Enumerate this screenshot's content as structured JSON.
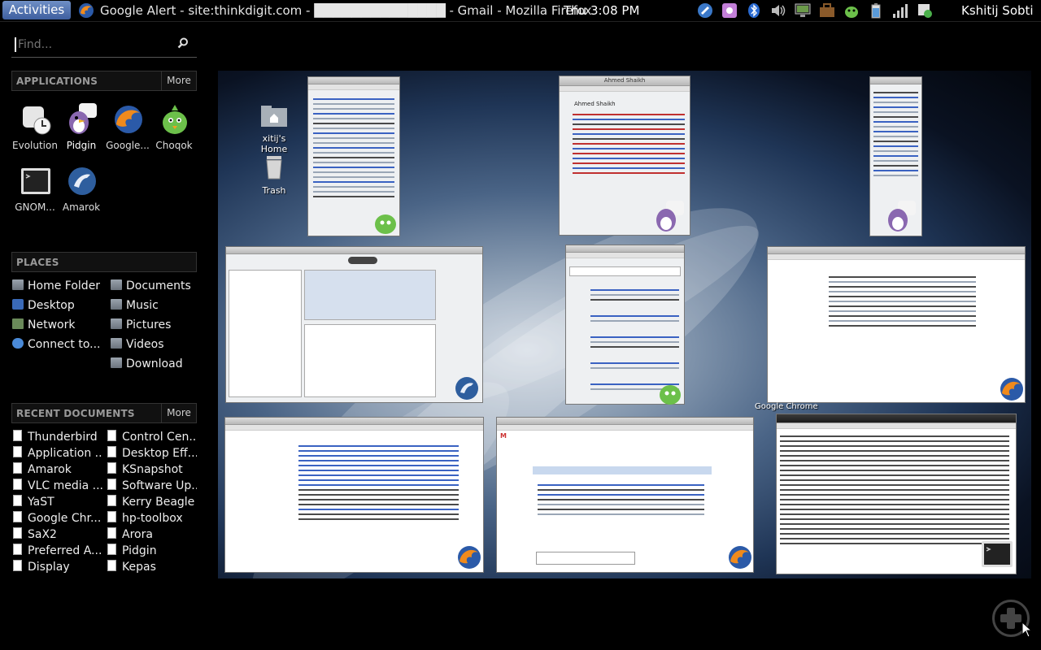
{
  "topbar": {
    "activities_label": "Activities",
    "window_title": "Google Alert - site:thinkdigit.com - ██████████████ - Gmail - Mozilla Firefox",
    "clock": "Thu  3:08 PM",
    "username": "Kshitij Sobti",
    "tray_icons": [
      "pidgin-tray-icon",
      "settings-tray-icon",
      "bluetooth-icon",
      "volume-icon",
      "display-icon",
      "briefcase-icon",
      "choqok-tray-icon",
      "battery-icon",
      "signal-icon",
      "update-icon"
    ]
  },
  "search": {
    "placeholder": "Find..."
  },
  "applications": {
    "header": "APPLICATIONS",
    "more": "More",
    "items": [
      {
        "label": "Evolution",
        "icon": "evolution-icon"
      },
      {
        "label": "Pidgin",
        "icon": "pidgin-icon"
      },
      {
        "label": "Google...",
        "icon": "firefox-icon"
      },
      {
        "label": "Choqok",
        "icon": "choqok-icon"
      },
      {
        "label": "GNOM...",
        "icon": "terminal-icon"
      },
      {
        "label": "Amarok",
        "icon": "amarok-icon"
      }
    ]
  },
  "places": {
    "header": "PLACES",
    "left": [
      "Home Folder",
      "Desktop",
      "Network",
      "Connect to..."
    ],
    "right": [
      "Documents",
      "Music",
      "Pictures",
      "Videos",
      "Download"
    ]
  },
  "recent": {
    "header": "RECENT DOCUMENTS",
    "more": "More",
    "left": [
      "Thunderbird",
      "Application ...",
      "Amarok",
      "VLC media ...",
      "YaST",
      "Google Chr...",
      "SaX2",
      "Preferred A...",
      "Display"
    ],
    "right": [
      "Control Cen...",
      "Desktop Eff...",
      "KSnapshot",
      "Software Up...",
      "Kerry Beagle",
      "hp-toolbox",
      "Arora",
      "Pidgin",
      "Kepas"
    ]
  },
  "desktop": {
    "home_label": "xitij's Home",
    "trash_label": "Trash"
  },
  "windows": {
    "chat_title": "Ahmed Shaikh",
    "chat_name": "Ahmed Shaikh",
    "chrome_caption": "Google Chrome"
  },
  "colors": {
    "activities": "#4f70b0",
    "background": "#000000"
  }
}
